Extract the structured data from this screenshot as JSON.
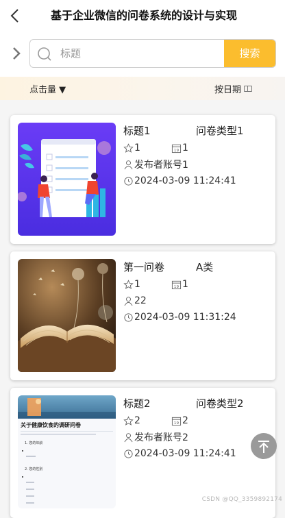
{
  "header": {
    "title": "基于企业微信的问卷系统的设计与实现"
  },
  "search": {
    "placeholder": "标题",
    "value": "",
    "button_label": "搜索"
  },
  "sort": {
    "by_clicks_label": "点击量 ▼",
    "by_date_label": "按日期"
  },
  "cards": [
    {
      "title": "标题1",
      "type": "问卷类型1",
      "stars": "1",
      "date_count": "1",
      "publisher": "发布者账号1",
      "datetime": "2024-03-09 11:24:41",
      "image": "illustration-people-survey"
    },
    {
      "title": "第一问卷",
      "type": "A类",
      "stars": "1",
      "date_count": "1",
      "publisher": "22",
      "datetime": "2024-03-09 11:31:24",
      "image": "photo-open-book"
    },
    {
      "title": "标题2",
      "type": "问卷类型2",
      "stars": "2",
      "date_count": "2",
      "publisher": "发布者账号2",
      "datetime": "2024-03-09 11:24:41",
      "image": "document-preview"
    }
  ],
  "thumb3": {
    "doc_title": "关于健康饮食的调研问卷",
    "sections": [
      "1. 您的年龄",
      "2. 您的性别"
    ]
  },
  "watermark": "CSDN @QQ_3359892174",
  "colors": {
    "accent": "#fbbd2e",
    "sort_bar": "#fdf3e1",
    "totop": "#9a9a9a"
  }
}
